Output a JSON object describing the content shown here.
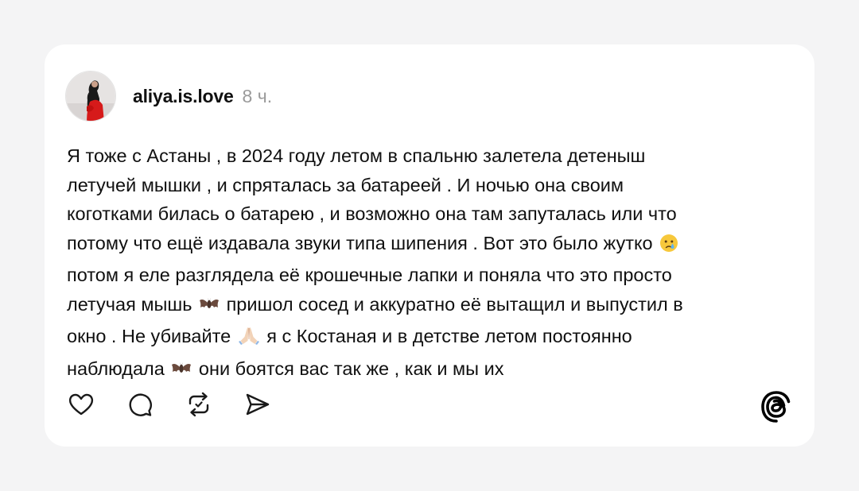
{
  "post": {
    "username": "aliya.is.love",
    "time": "8 ч.",
    "lines": [
      {
        "text": "Я тоже с Астаны , в 2024 году летом в спальню залетела детеныш"
      },
      {
        "text": "летучей мышки , и спряталась за батареей . И ночью она своим"
      },
      {
        "text": "коготками билась о батарею , и возможно она там запуталась или что"
      },
      {
        "before": "потому что ещё издавала звуки типа шипения . Вот это было жутко",
        "emoji": "crying-face-icon",
        "after": ""
      },
      {
        "text": "потом я еле разглядела её крошечные лапки и поняла что это просто"
      },
      {
        "before": "летучая мышь",
        "emoji": "bat-icon",
        "after": "пришол сосед и аккуратно её вытащил и выпустил в"
      },
      {
        "before": "окно . Не убивайте",
        "emoji": "folded-hands-icon",
        "after": " я с Костаная и в детстве летом постоянно"
      },
      {
        "before": "наблюдала",
        "emoji": "bat-icon",
        "after": "они боятся вас так же , как и мы их"
      }
    ]
  },
  "actions": {
    "like": "heart-icon",
    "reply": "comment-icon",
    "repost": "repost-icon",
    "share": "send-icon"
  },
  "brand": {
    "logo": "threads-logo-icon"
  }
}
